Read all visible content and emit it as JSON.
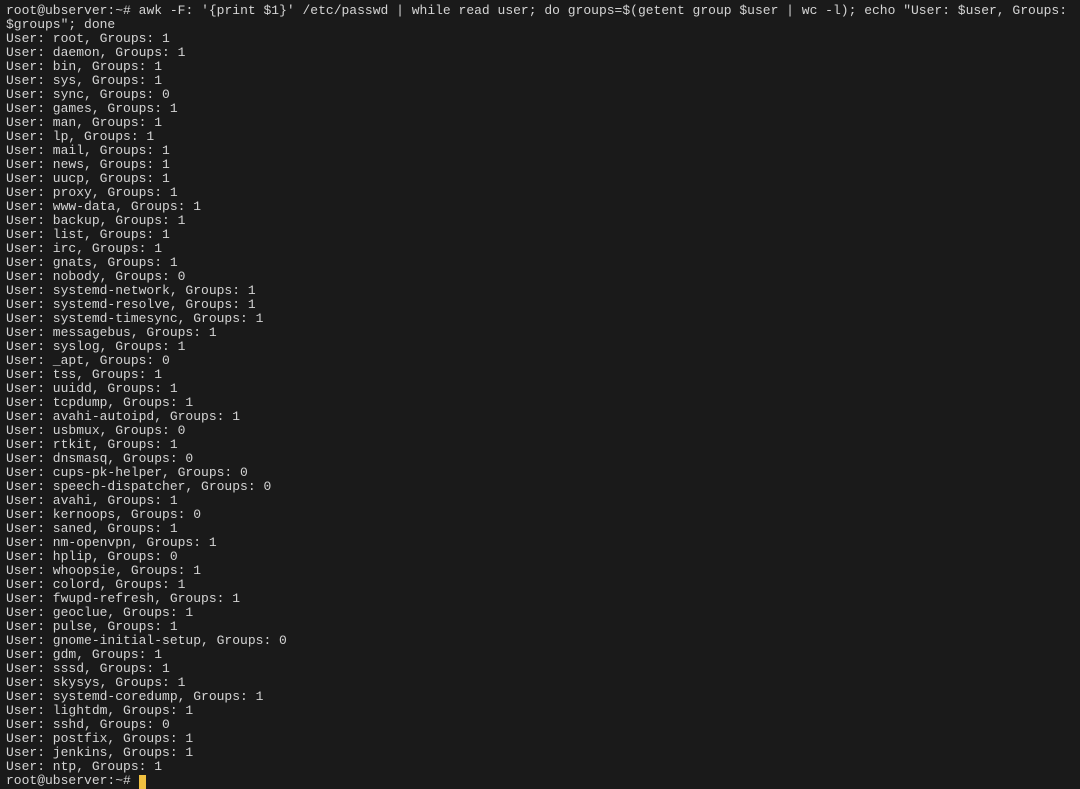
{
  "prompt": {
    "user_host": "root@ubserver",
    "path": "~",
    "symbol": "#"
  },
  "command": "awk -F: '{print $1}' /etc/passwd | while read user; do groups=$(getent group $user | wc -l); echo \"User: $user, Groups: $groups\"; done",
  "output_lines": [
    "User: root, Groups: 1",
    "User: daemon, Groups: 1",
    "User: bin, Groups: 1",
    "User: sys, Groups: 1",
    "User: sync, Groups: 0",
    "User: games, Groups: 1",
    "User: man, Groups: 1",
    "User: lp, Groups: 1",
    "User: mail, Groups: 1",
    "User: news, Groups: 1",
    "User: uucp, Groups: 1",
    "User: proxy, Groups: 1",
    "User: www-data, Groups: 1",
    "User: backup, Groups: 1",
    "User: list, Groups: 1",
    "User: irc, Groups: 1",
    "User: gnats, Groups: 1",
    "User: nobody, Groups: 0",
    "User: systemd-network, Groups: 1",
    "User: systemd-resolve, Groups: 1",
    "User: systemd-timesync, Groups: 1",
    "User: messagebus, Groups: 1",
    "User: syslog, Groups: 1",
    "User: _apt, Groups: 0",
    "User: tss, Groups: 1",
    "User: uuidd, Groups: 1",
    "User: tcpdump, Groups: 1",
    "User: avahi-autoipd, Groups: 1",
    "User: usbmux, Groups: 0",
    "User: rtkit, Groups: 1",
    "User: dnsmasq, Groups: 0",
    "User: cups-pk-helper, Groups: 0",
    "User: speech-dispatcher, Groups: 0",
    "User: avahi, Groups: 1",
    "User: kernoops, Groups: 0",
    "User: saned, Groups: 1",
    "User: nm-openvpn, Groups: 1",
    "User: hplip, Groups: 0",
    "User: whoopsie, Groups: 1",
    "User: colord, Groups: 1",
    "User: fwupd-refresh, Groups: 1",
    "User: geoclue, Groups: 1",
    "User: pulse, Groups: 1",
    "User: gnome-initial-setup, Groups: 0",
    "User: gdm, Groups: 1",
    "User: sssd, Groups: 1",
    "User: skysys, Groups: 1",
    "User: systemd-coredump, Groups: 1",
    "User: lightdm, Groups: 1",
    "User: sshd, Groups: 0",
    "User: postfix, Groups: 1",
    "User: jenkins, Groups: 1",
    "User: ntp, Groups: 1"
  ]
}
